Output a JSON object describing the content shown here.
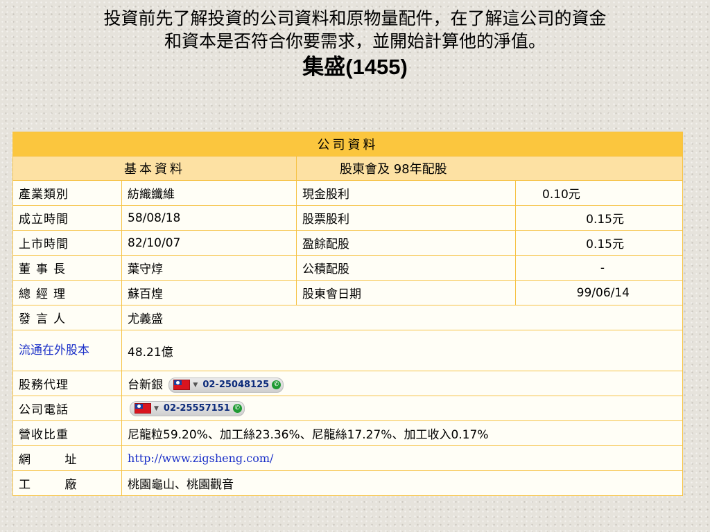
{
  "intro_line1": "投資前先了解投資的公司資料和原物量配件，在了解這公司的資金",
  "intro_line2": "和資本是否符合你要需求，並開始計算他的淨值。",
  "heading_name": "集盛",
  "heading_code": "(1455)",
  "table": {
    "header": "公司資料",
    "section_left": "基本資料",
    "section_right": "股東會及 98年配股",
    "industry_label": "產業類別",
    "industry_value": "紡織纖維",
    "founded_label": "成立時間",
    "founded_value": "58/08/18",
    "listed_label": "上市時間",
    "listed_value": "82/10/07",
    "chairman_label": "董事長",
    "chairman_value": "葉守焞",
    "gm_label": "總經理",
    "gm_value": "蘇百煌",
    "spokesman_label": "發言人",
    "spokesman_value": "尤義盛",
    "shares_label": "流通在外股本",
    "shares_value": "48.21億",
    "agent_label": "股務代理",
    "agent_value": "台新銀",
    "agent_phone": "02-25048125",
    "phone_label": "公司電話",
    "phone_value": "02-25557151",
    "revenue_label": "營收比重",
    "revenue_value": "尼龍粒59.20%、加工絲23.36%、尼龍絲17.27%、加工收入0.17%",
    "website_label": "網 址",
    "website_value": "http://www.zigsheng.com/",
    "factory_label": "工 廠",
    "factory_value": "桃園龜山、桃園觀音",
    "cash_div_label": "現金股利",
    "cash_div_value": "0.10元",
    "stock_div_label": "股票股利",
    "stock_div_value": "0.15元",
    "earnings_div_label": "盈餘配股",
    "earnings_div_value": "0.15元",
    "reserve_div_label": "公積配股",
    "reserve_div_value": "-",
    "meeting_label": "股東會日期",
    "meeting_value": "99/06/14"
  },
  "colors": {
    "header_bg": "#fbc63e",
    "subheader_bg": "#fde1a3",
    "border": "#f6c244",
    "link": "#1a2fc8"
  },
  "icons": [
    "taiwan-flag-icon",
    "chevron-down-icon",
    "phone-icon"
  ]
}
